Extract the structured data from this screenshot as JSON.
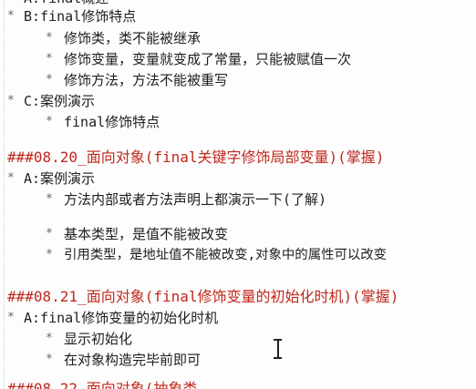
{
  "document": {
    "top_partial": "A:final概述",
    "sections": [
      {
        "label": "B:final修饰特点",
        "items": [
          "修饰类，类不能被继承",
          "修饰变量，变量就变成了常量，只能被赋值一次",
          "修饰方法，方法不能被重写"
        ]
      },
      {
        "label": "C:案例演示",
        "items": [
          "final修饰特点"
        ]
      }
    ],
    "heading_0820": "###08.20_面向对象(final关键字修饰局部变量)(掌握)",
    "section_0820": {
      "label": "A:案例演示",
      "items": [
        "方法内部或者方法声明上都演示一下(了解)",
        "基本类型，是值不能被改变",
        "引用类型，是地址值不能被改变,对象中的属性可以改变"
      ]
    },
    "heading_0821": "###08.21_面向对象(final修饰变量的初始化时机)(掌握)",
    "section_0821": {
      "label": "A:final修饰变量的初始化时机",
      "items": [
        "显示初始化",
        "在对象构造完毕前即可"
      ]
    },
    "bottom_partial": "###08.22_面向对象(抽象类"
  }
}
